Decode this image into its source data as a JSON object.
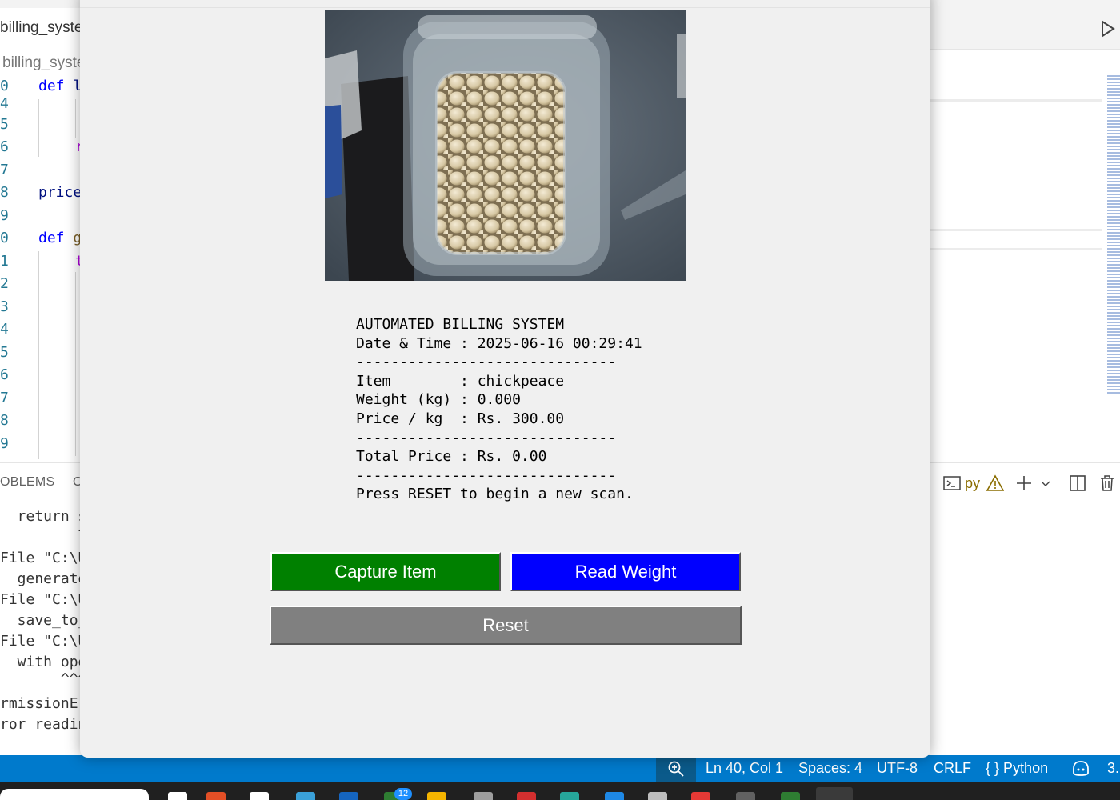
{
  "vscode": {
    "tab_title": "billing_system",
    "breadcrumb": "billing_system",
    "line_numbers": [
      "0",
      "4",
      "5",
      "6",
      "7",
      "8",
      "9",
      "0",
      "1",
      "2",
      "3",
      "4",
      "5",
      "6",
      "7",
      "8",
      "9"
    ],
    "code_lines": [
      {
        "kw": "def ",
        "rest": "l"
      },
      {
        "kw": "",
        "rest": ""
      },
      {
        "kw": "",
        "rest": ""
      },
      {
        "kw": "",
        "rest": "r"
      },
      {
        "kw": "",
        "rest": ""
      },
      {
        "kw": "",
        "rest": "price"
      },
      {
        "kw": "",
        "rest": ""
      },
      {
        "kw": "def ",
        "rest": "g"
      },
      {
        "kw": "",
        "rest": "t"
      }
    ],
    "panel_tab_problems": "OBLEMS",
    "panel_tab_output": "O",
    "panel_toolbar": {
      "terminal_label": "py"
    },
    "terminal_lines": [
      "  return s",
      "         ^",
      "File \"C:\\U",
      "  generate",
      "File \"C:\\U",
      "  save_to_",
      "File \"C:\\U",
      "  with ope",
      "       ^^^",
      "rmissionEr",
      "ror readin"
    ],
    "status": {
      "position": "Ln 40, Col 1",
      "spaces": "Spaces: 4",
      "encoding": "UTF-8",
      "eol": "CRLF",
      "language": "Python",
      "version": "3."
    },
    "taskbar_badge": "12"
  },
  "app": {
    "receipt": {
      "title": "AUTOMATED BILLING SYSTEM",
      "datetime": "Date & Time : 2025-06-16 00:29:41",
      "separator": "------------------------------",
      "item": "Item        : chickpeace",
      "weight": "Weight (kg) : 0.000",
      "price_per_kg": "Price / kg  : Rs. 300.00",
      "total": "Total Price : Rs. 0.00",
      "footer": "Press RESET to begin a new scan."
    },
    "buttons": {
      "capture": "Capture Item",
      "read_weight": "Read Weight",
      "reset": "Reset"
    },
    "colors": {
      "capture": "#008000",
      "read_weight": "#0000ff",
      "reset": "#808080"
    },
    "captured_image_icon": "chickpea-container-photo"
  }
}
